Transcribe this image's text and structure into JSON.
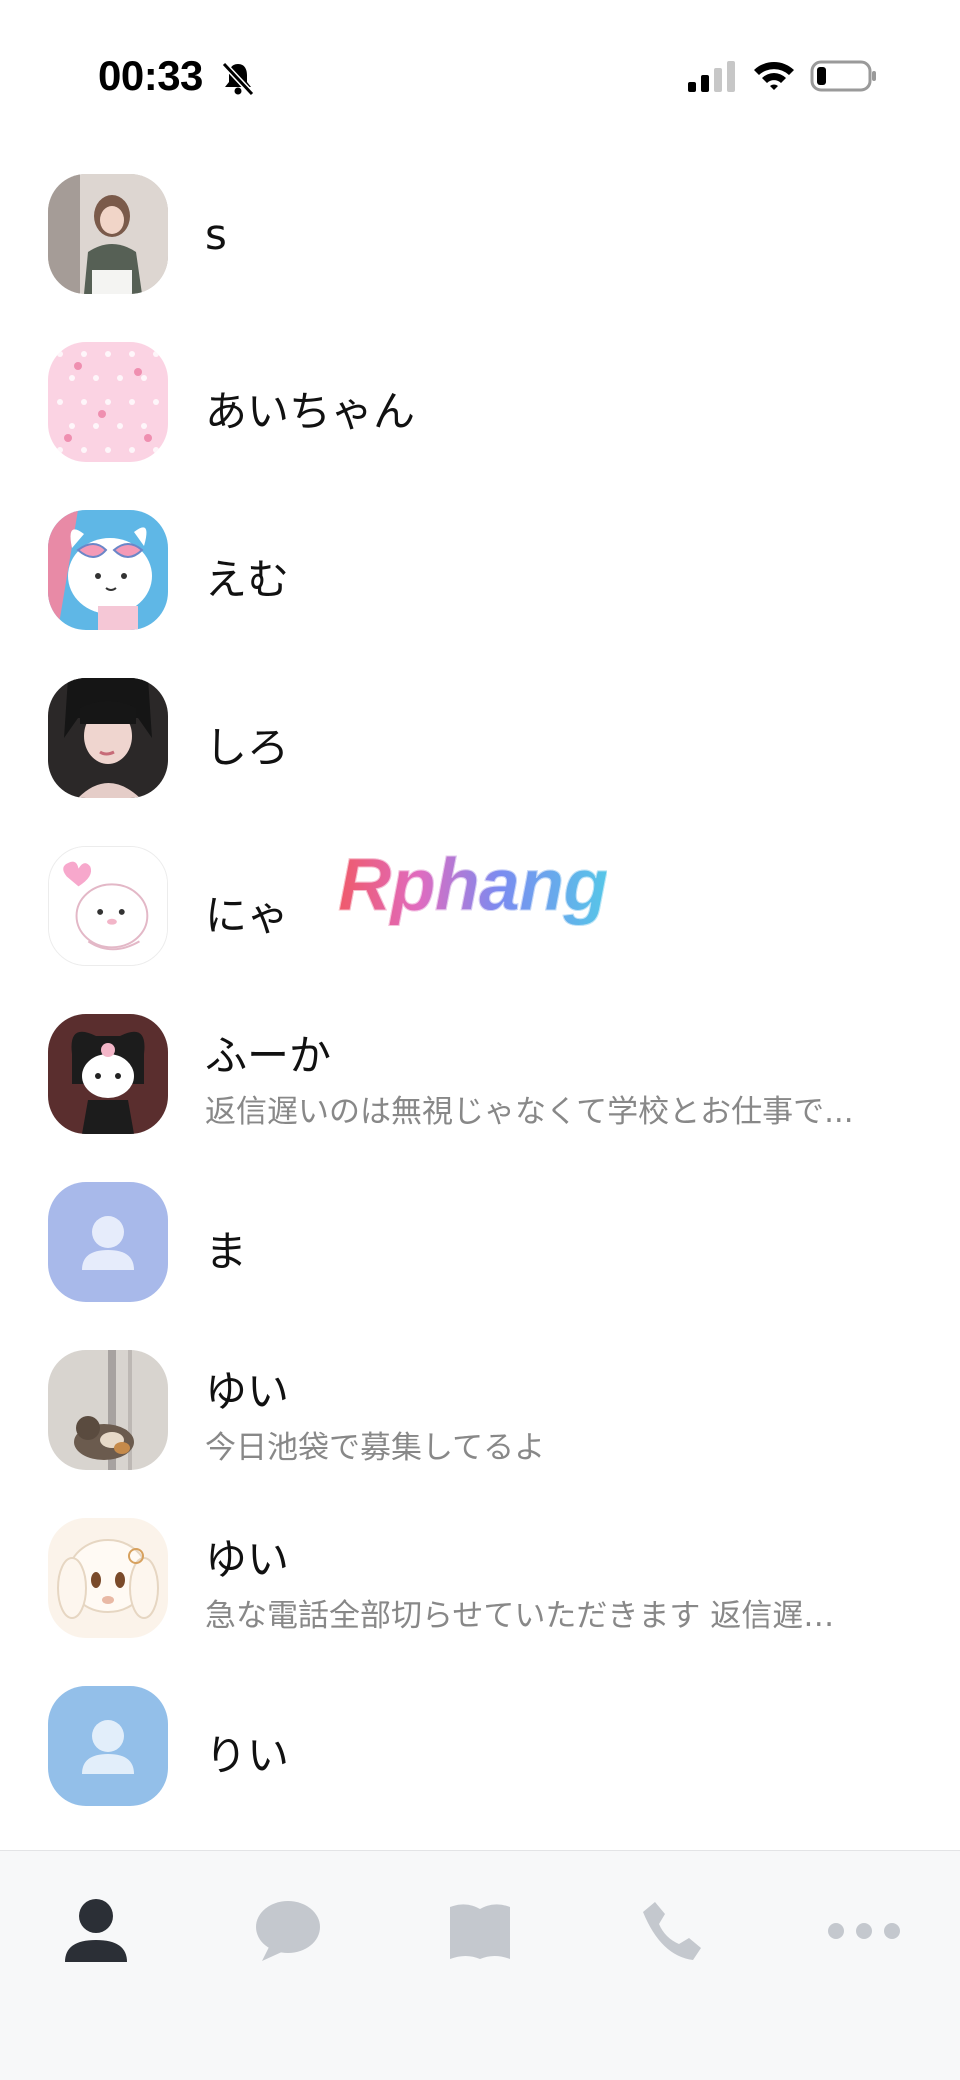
{
  "status_bar": {
    "time": "00:33"
  },
  "friends": [
    {
      "name": "s",
      "message": ""
    },
    {
      "name": "あいちゃん",
      "message": ""
    },
    {
      "name": "えむ",
      "message": ""
    },
    {
      "name": "しろ",
      "message": ""
    },
    {
      "name": "にゃ",
      "message": ""
    },
    {
      "name": "ふーか",
      "message": "返信遅いのは無視じゃなくて学校とお仕事で..."
    },
    {
      "name": "ま",
      "message": ""
    },
    {
      "name": "ゆい",
      "message": "今日池袋で募集してるよ"
    },
    {
      "name": "ゆい",
      "message": "急な電話全部切らせていただきます 返信遅…"
    },
    {
      "name": "りい",
      "message": ""
    }
  ],
  "watermark": "Rphang",
  "tabs": [
    {
      "icon": "person-icon",
      "active": true
    },
    {
      "icon": "chat-bubble-icon",
      "active": false
    },
    {
      "icon": "book-icon",
      "active": false
    },
    {
      "icon": "phone-icon",
      "active": false
    },
    {
      "icon": "more-dots-icon",
      "active": false
    }
  ],
  "colors": {
    "tab_active": "#2b2f36",
    "tab_inactive": "#c4c8ce",
    "secondary_text": "#888888"
  }
}
